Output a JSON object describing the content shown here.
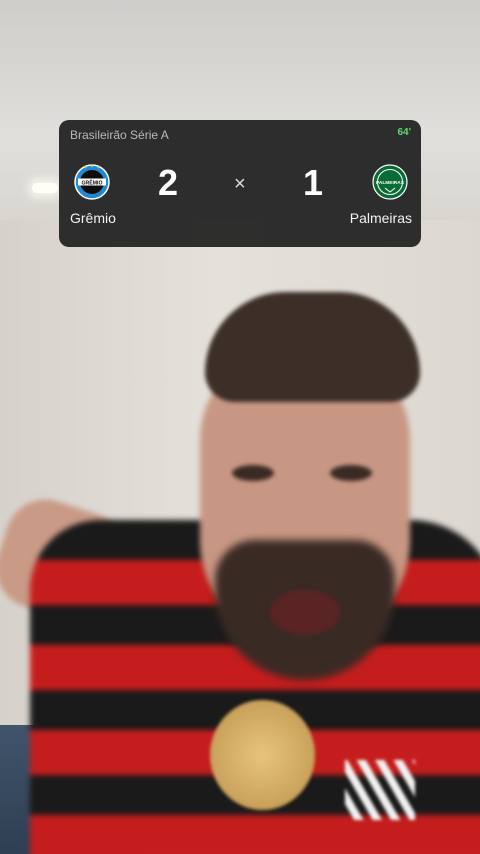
{
  "widget": {
    "league": "Brasileirão Série A",
    "minute": "64'",
    "separator": "×",
    "home": {
      "name": "Grêmio",
      "score": "2",
      "logo_text": "GRÊMIO",
      "logo_icon": "gremio-crest-icon"
    },
    "away": {
      "name": "Palmeiras",
      "score": "1",
      "logo_text": "PALMEIRAS",
      "logo_icon": "palmeiras-crest-icon"
    }
  },
  "colors": {
    "panel": "#222222",
    "minute": "#5ed96a",
    "gremio_blue": "#1f8ad6",
    "palmeiras_green": "#0a6b36"
  }
}
